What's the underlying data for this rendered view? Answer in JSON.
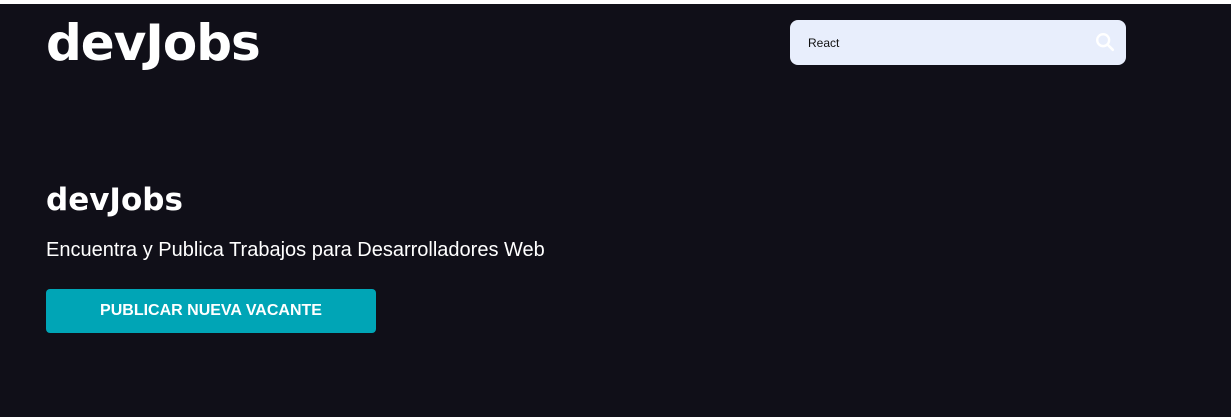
{
  "header": {
    "logo": "devJobs"
  },
  "search": {
    "value": "React",
    "icon": "search-icon"
  },
  "hero": {
    "title": "devJobs",
    "subtitle": "Encuentra y Publica Trabajos para Desarrolladores Web",
    "cta_label": "PUBLICAR NUEVA VACANTE"
  },
  "colors": {
    "background": "#100f18",
    "search_background": "#e8eefc",
    "accent": "#00a5b6",
    "text": "#ffffff"
  }
}
